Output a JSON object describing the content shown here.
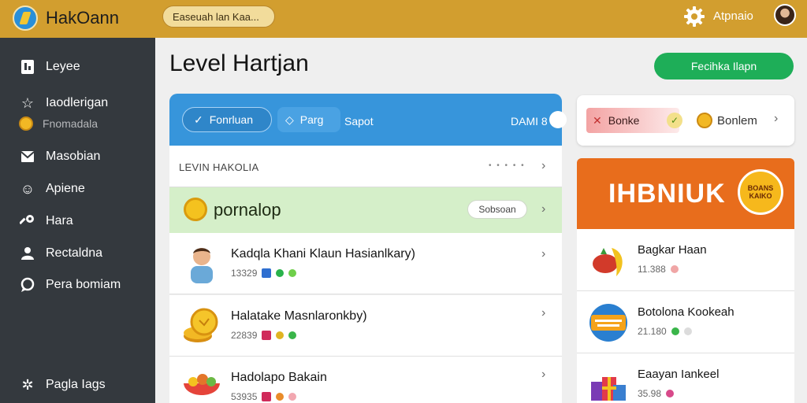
{
  "header": {
    "app_title": "HakOann",
    "search_text": "Easeuah lan  Kaa...",
    "user_name": "Atpnaio"
  },
  "sidebar": {
    "items": [
      {
        "label": "Leyee",
        "icon": "document-icon"
      },
      {
        "label": "Iaodlerigan",
        "icon": "star-icon"
      },
      {
        "label": "Masobian",
        "icon": "mail-icon"
      },
      {
        "label": "Apiene",
        "icon": "smile-icon"
      },
      {
        "label": "Hara",
        "icon": "key-icon"
      },
      {
        "label": "Rectaldna",
        "icon": "user-icon"
      },
      {
        "label": "Pera bomiam",
        "icon": "chat-icon"
      }
    ],
    "sub_item": "Fnomadala",
    "footer_item": "Pagla Iags"
  },
  "page": {
    "title": "Level  Hartjan",
    "primary_button": "Fecihka Ilapn"
  },
  "tabs": {
    "active": "Fonrluan",
    "second": "Parg",
    "third": "Sapot",
    "right_label": "DAMI 8"
  },
  "list": {
    "header_label": "LEVIN HAKOLIA",
    "header_dots": "• • • • •",
    "promo": {
      "label": "pornalop",
      "button": "Sobsoan"
    },
    "items": [
      {
        "title": "Kadqla Khani Klaun Hasianlkary)",
        "meta": "13329"
      },
      {
        "title": "Halatake Masnlaronkby)",
        "meta": "22839"
      },
      {
        "title": "Hadolapo Bakain",
        "meta": "53935"
      }
    ]
  },
  "right": {
    "card": {
      "badge": "Bonke",
      "label": "Bonlem"
    },
    "banner": {
      "title": "IHBNIUK",
      "badge": "BOANS KAIKO"
    },
    "items": [
      {
        "title": "Bagkar Haan",
        "meta": "11.388"
      },
      {
        "title": "Botolona Kookeah",
        "meta": "21.180"
      },
      {
        "title": "Eaayan Iankeel",
        "meta": "35.98"
      }
    ]
  },
  "colors": {
    "header": "#d29e2f",
    "sidebar": "#34393e",
    "accent_blue": "#3795db",
    "primary_green": "#1eae58",
    "banner_orange": "#e86d1c"
  }
}
